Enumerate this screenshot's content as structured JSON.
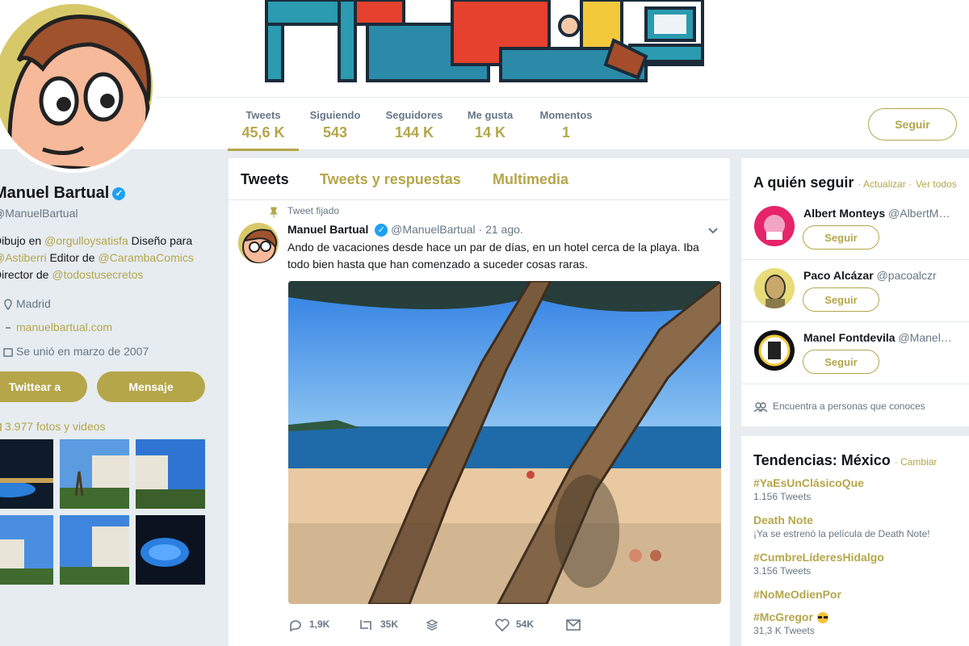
{
  "nav": {
    "stats": [
      {
        "label": "Tweets",
        "value": "45,6 K"
      },
      {
        "label": "Siguiendo",
        "value": "543"
      },
      {
        "label": "Seguidores",
        "value": "144 K"
      },
      {
        "label": "Me gusta",
        "value": "14 K"
      },
      {
        "label": "Momentos",
        "value": "1"
      }
    ],
    "follow_label": "Seguir"
  },
  "profile": {
    "name": "Manuel Bartual",
    "handle": "@ManuelBartual",
    "bio_1": "Dibujo en ",
    "bio_link_1": "@orgulloysatisfa",
    "bio_2": " Diseño para ",
    "bio_link_2": "@Astiberri",
    "bio_3": " Editor de ",
    "bio_link_3": "@CarambaComics",
    "bio_4": " Director de ",
    "bio_link_4": "@todostusecretos",
    "location": "Madrid",
    "website": "manuelbartual.com",
    "joined": "Se unió en marzo de 2007",
    "tweet_to_label": "Twittear a",
    "message_label": "Mensaje",
    "media_label": "3.977 fotos y videos"
  },
  "timeline": {
    "tabs": [
      "Tweets",
      "Tweets y respuestas",
      "Multimedia"
    ],
    "tweet": {
      "pinned_label": "Tweet fijado",
      "author": "Manuel Bartual",
      "handle": "@ManuelBartual",
      "date": "· 21 ago.",
      "text": "Ando de vacaciones desde hace un par de días, en un hotel cerca de la playa. Iba todo bien hasta que han comenzado a suceder cosas raras.",
      "replies": "1,9K",
      "retweets": "35K",
      "likes": "54K"
    }
  },
  "who_to_follow": {
    "title": "A quién seguir",
    "refresh": "· Actualizar ·",
    "view_all": "Ver todos",
    "users": [
      {
        "name": "Albert Monteys",
        "handle": "@AlbertM…",
        "button": "Seguir"
      },
      {
        "name": "Paco Alcázar",
        "handle": "@pacoalczr",
        "button": "Seguir"
      },
      {
        "name": "Manel Fontdevila",
        "handle": "@Manel…",
        "button": "Seguir"
      }
    ],
    "find_people": "Encuentra a personas que conoces"
  },
  "trends": {
    "title": "Tendencias: México",
    "change": "· Cambiar",
    "items": [
      {
        "tag": "#YaEsUnClásicoQue",
        "count": "1.156 Tweets"
      },
      {
        "tag": "Death Note",
        "count": "¡Ya se estrenó la película de Death Note!"
      },
      {
        "tag": "#CumbreLíderesHidalgo",
        "count": "3.156 Tweets"
      },
      {
        "tag": "#NoMeOdienPor",
        "count": ""
      },
      {
        "tag": "#McGregor",
        "count": "31,3 K Tweets"
      }
    ]
  },
  "colors": {
    "accent": "#b5a64a",
    "verified": "#1da1f2",
    "background": "#e6ecf0"
  }
}
